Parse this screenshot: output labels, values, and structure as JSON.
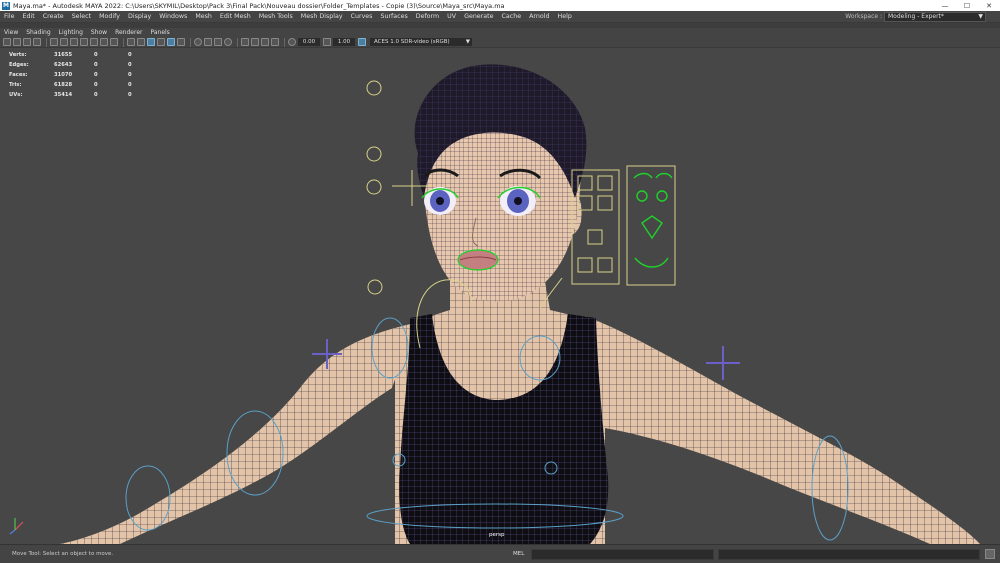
{
  "window": {
    "app_icon_letter": "M",
    "title": "Maya.ma* - Autodesk MAYA 2022: C:\\Users\\SKYMIL\\Desktop\\Pack 3\\Final Pack\\Nouveau dossier\\Folder_Templates - Copie (3)\\Source\\Maya_src\\Maya.ma",
    "minimize": "—",
    "maximize": "☐",
    "close": "✕"
  },
  "menubar": {
    "items": [
      "File",
      "Edit",
      "Create",
      "Select",
      "Modify",
      "Display",
      "Windows",
      "Mesh",
      "Edit Mesh",
      "Mesh Tools",
      "Mesh Display",
      "Curves",
      "Surfaces",
      "Deform",
      "UV",
      "Generate",
      "Cache",
      "Arnold",
      "Help"
    ],
    "workspace_label": "Workspace :",
    "workspace_value": "Modeling - Expert*"
  },
  "panel_menu": {
    "items": [
      "View",
      "Shading",
      "Lighting",
      "Show",
      "Renderer",
      "Panels"
    ]
  },
  "toolbar": {
    "exposure": "0.00",
    "gamma": "1.00",
    "color_space": "ACES 1.0 SDR-video (sRGB)"
  },
  "hud": {
    "rows": [
      {
        "label": "Verts:",
        "v1": "31655",
        "v2": "0",
        "v3": "0"
      },
      {
        "label": "Edges:",
        "v1": "62643",
        "v2": "0",
        "v3": "0"
      },
      {
        "label": "Faces:",
        "v1": "31070",
        "v2": "0",
        "v3": "0"
      },
      {
        "label": "Tris:",
        "v1": "61828",
        "v2": "0",
        "v3": "0"
      },
      {
        "label": "UVs:",
        "v1": "35414",
        "v2": "0",
        "v3": "0"
      }
    ]
  },
  "viewport": {
    "camera_label": "persp",
    "background_color": "#474747",
    "skin_color": "#e4c4a8",
    "wire_color": "#1d1d2e",
    "rig_yellow": "#d8d28a",
    "rig_blue": "#5aa0c8"
  },
  "status": {
    "help_text": "Move Tool: Select an object to move.",
    "mel_label": "MEL"
  }
}
